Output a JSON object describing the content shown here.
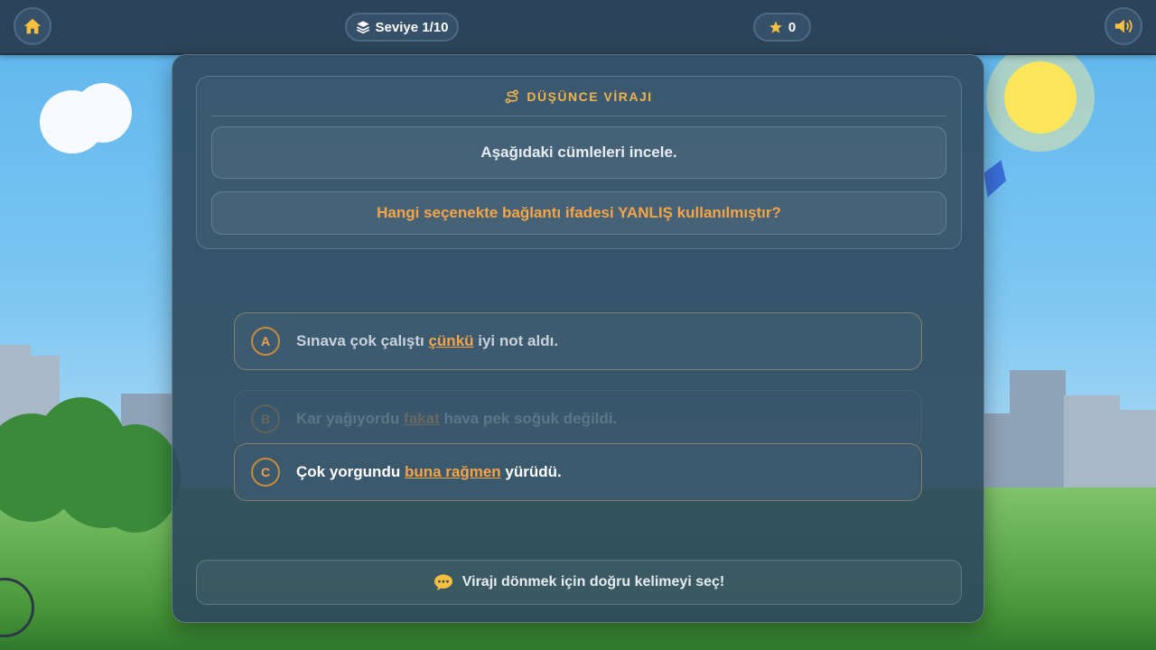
{
  "topbar": {
    "home_icon": "home-icon",
    "level_icon": "layers-icon",
    "level_label": "Seviye 1/10",
    "score_icon": "star-icon",
    "score_value": "0",
    "sound_icon": "speaker-icon"
  },
  "question": {
    "section_icon": "route-icon",
    "section_title": "DÜŞÜNCE VİRAJI",
    "instruction": "Aşağıdaki cümleleri incele.",
    "prompt": "Hangi seçenekte bağlantı ifadesi YANLIŞ kullanılmıştır?"
  },
  "options": [
    {
      "letter": "A",
      "before": "Sınava çok çalıştı ",
      "connector": "çünkü",
      "after": " iyi not aldı."
    },
    {
      "letter": "B",
      "before": "Kar yağıyordu ",
      "connector": "fakat",
      "after": " hava pek soğuk değildi."
    },
    {
      "letter": "C",
      "before": "Çok yorgundu ",
      "connector": "buna rağmen",
      "after": " yürüdü."
    }
  ],
  "hint": {
    "icon": "speech-bubble-icon",
    "text": "Virajı dönmek için doğru kelimeyi seç!"
  },
  "colors": {
    "accent": "#f5a447",
    "panel": "#2c485c",
    "topbar": "#2c4459"
  }
}
